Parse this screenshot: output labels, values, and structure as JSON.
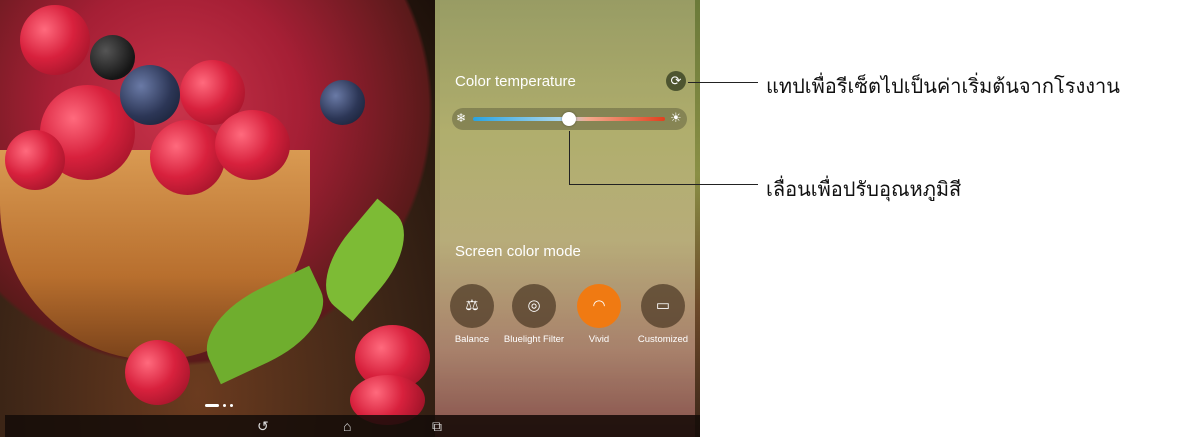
{
  "color_temperature": {
    "title": "Color temperature",
    "reset_icon": "refresh-icon",
    "slider_value_percent": 50,
    "cold_icon": "snowflake-icon",
    "warm_icon": "sun-icon"
  },
  "screen_color_mode": {
    "title": "Screen color mode",
    "selected": "Vivid",
    "modes": [
      {
        "label": "Balance",
        "icon": "balance-scale-icon",
        "glyph": "⚖"
      },
      {
        "label": "Bluelight Filter",
        "icon": "eye-shield-icon",
        "glyph": "◎"
      },
      {
        "label": "Vivid",
        "icon": "rainbow-icon",
        "glyph": "◠"
      },
      {
        "label": "Customized",
        "icon": "screen-settings-icon",
        "glyph": "▭"
      }
    ]
  },
  "nav_bar": {
    "back_glyph": "↺",
    "home_glyph": "⌂",
    "recent_glyph": "⧉"
  },
  "callouts": {
    "reset": "แทปเพื่อรีเซ็ตไปเป็นค่าเริ่มต้นจากโรงงาน",
    "slide": "เลื่อนเพื่อปรับอุณหภูมิสี"
  },
  "colors": {
    "accent": "#f07a12",
    "slider_cold": "#2aa3e0",
    "slider_warm": "#e0401e"
  }
}
